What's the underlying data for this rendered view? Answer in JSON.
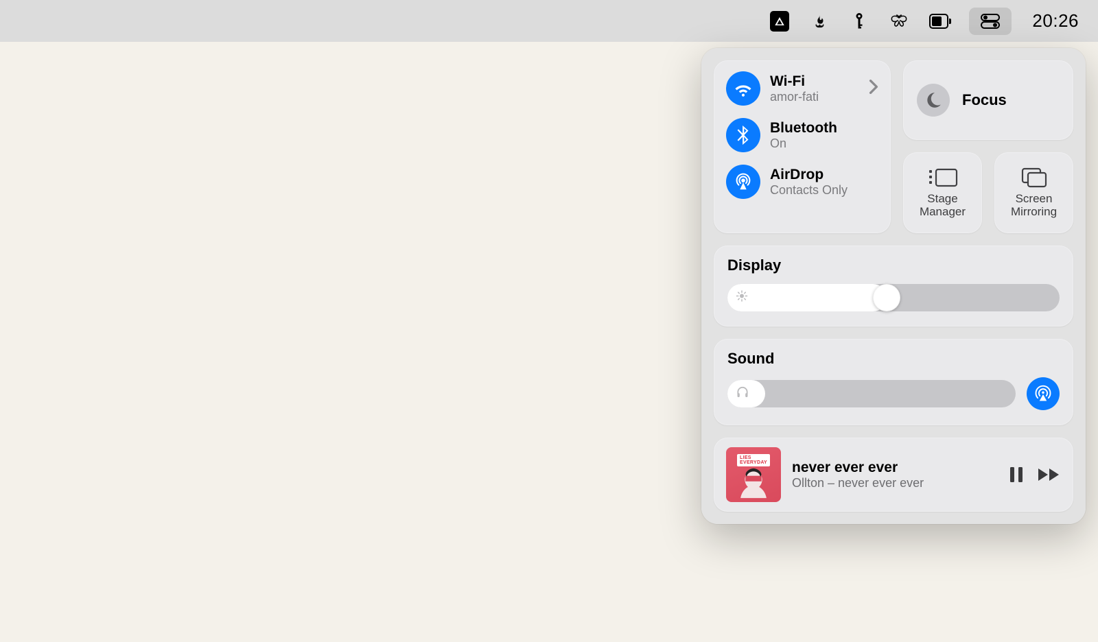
{
  "menubar": {
    "time": "20:26"
  },
  "connectivity": {
    "wifi": {
      "title": "Wi-Fi",
      "status": "amor-fati"
    },
    "bluetooth": {
      "title": "Bluetooth",
      "status": "On"
    },
    "airdrop": {
      "title": "AirDrop",
      "status": "Contacts Only"
    }
  },
  "focus": {
    "label": "Focus"
  },
  "stage_manager": {
    "label1": "Stage",
    "label2": "Manager"
  },
  "screen_mirroring": {
    "label1": "Screen",
    "label2": "Mirroring"
  },
  "display": {
    "label": "Display",
    "value_percent": 48
  },
  "sound": {
    "label": "Sound",
    "value_percent": 13
  },
  "media": {
    "title": "never ever ever",
    "subtitle": "Ollton – never ever ever",
    "art_tag": "LIES EVERYDAY"
  },
  "colors": {
    "accent": "#0a7bff"
  }
}
